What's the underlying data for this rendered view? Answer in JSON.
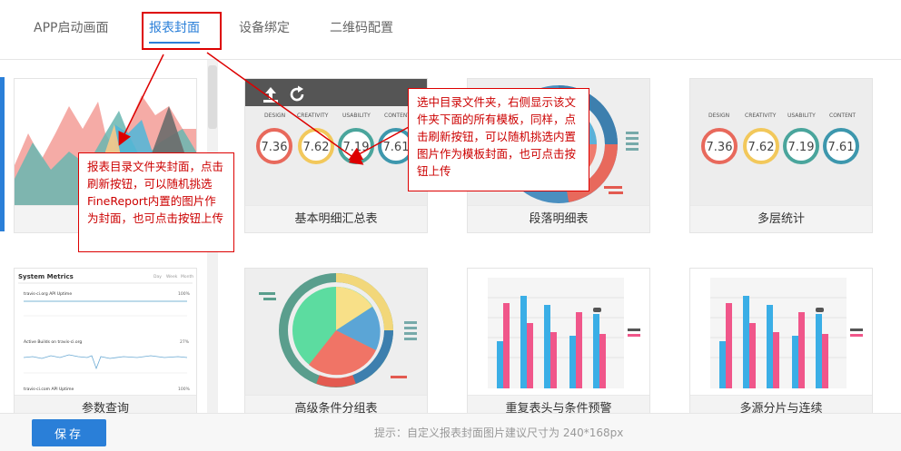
{
  "tabs": [
    {
      "label": "APP启动画面"
    },
    {
      "label": "报表封面"
    },
    {
      "label": "设备绑定"
    },
    {
      "label": "二维码配置"
    }
  ],
  "cards": [
    {
      "label": ""
    },
    {
      "label": "基本明细汇总表"
    },
    {
      "label": "段落明细表"
    },
    {
      "label": "多层统计"
    },
    {
      "label": "参数查询"
    },
    {
      "label": "高级条件分组表"
    },
    {
      "label": "重复表头与条件预警"
    },
    {
      "label": "多源分片与连续"
    }
  ],
  "gauge_labels": [
    "DESIGN",
    "CREATIVITY",
    "USABILITY",
    "CONTENT"
  ],
  "gauge_values": [
    "7.36",
    "7.62",
    "7.19",
    "7.61"
  ],
  "metrics": {
    "title": "System Metrics",
    "ranges": [
      "Day",
      "Week",
      "Month"
    ],
    "row1": "travis-ci.org API Uptime",
    "row1_value": "100%",
    "row2": "Active Builds on travis-ci.org",
    "row2_value": "27%",
    "row3": "travis-ci.com API Uptime",
    "row3_value": "100%"
  },
  "callouts": {
    "left": "报表目录文件夹封面，点击刷新按钮，可以随机挑选FineReport内置的图片作为封面，也可点击按钮上传",
    "right": "选中目录文件夹，右侧显示该文件夹下面的所有模板，同样，点击刷新按钮，可以随机挑选内置图片作为模板封面，也可点击按钮上传"
  },
  "footer": {
    "save": "保存",
    "hint": "提示：自定义报表封面图片建议尺寸为 240*168px"
  }
}
